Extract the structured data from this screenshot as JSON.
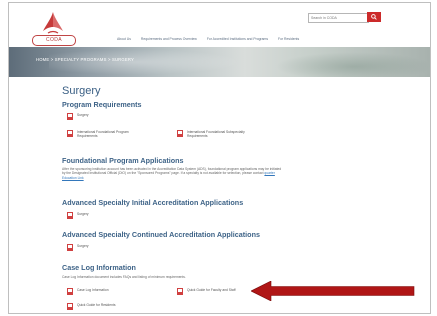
{
  "header": {
    "search_placeholder": "Search in CODA",
    "search_button_icon": "search-icon",
    "logo_text": "CODA",
    "nav": [
      "About Us",
      "Requirements and Process Overview",
      "For Accredited Institutions and Programs",
      "For Residents"
    ]
  },
  "breadcrumb": "HOME > SPECIALTY PROGRAMS > SURGERY",
  "page_title": "Surgery",
  "sections": {
    "program_requirements": {
      "heading": "Program Requirements",
      "items": [
        "Surgery",
        "International Foundational Program Requirements",
        "International Foundational Subspecialty Requirements"
      ]
    },
    "foundational": {
      "heading": "Foundational Program Applications",
      "text": "After the sponsoring institution account has been activated in the Accreditation Data System (ADS), foundational program applications may be initiated by the Designated Institutional Official (DIO) on the \"Sponsored Programs\" page. If a specialty is not available for selection, please contact",
      "link": "quarter Education Link"
    },
    "advanced_initial": {
      "heading": "Advanced Specialty Initial Accreditation Applications",
      "items": [
        "Surgery"
      ]
    },
    "advanced_continued": {
      "heading": "Advanced Specialty Continued Accreditation Applications",
      "items": [
        "Surgery"
      ]
    },
    "case_log": {
      "heading": "Case Log Information",
      "text": "Case Log Information document includes FAQs and listing of minimum requirements.",
      "items": [
        "Case Log Information",
        "Quick Guide for Faculty and Staff",
        "Quick Guide for Residents"
      ]
    }
  },
  "colors": {
    "accent": "#cc2a2a",
    "heading": "#3f6488",
    "arrow": "#b01616"
  }
}
